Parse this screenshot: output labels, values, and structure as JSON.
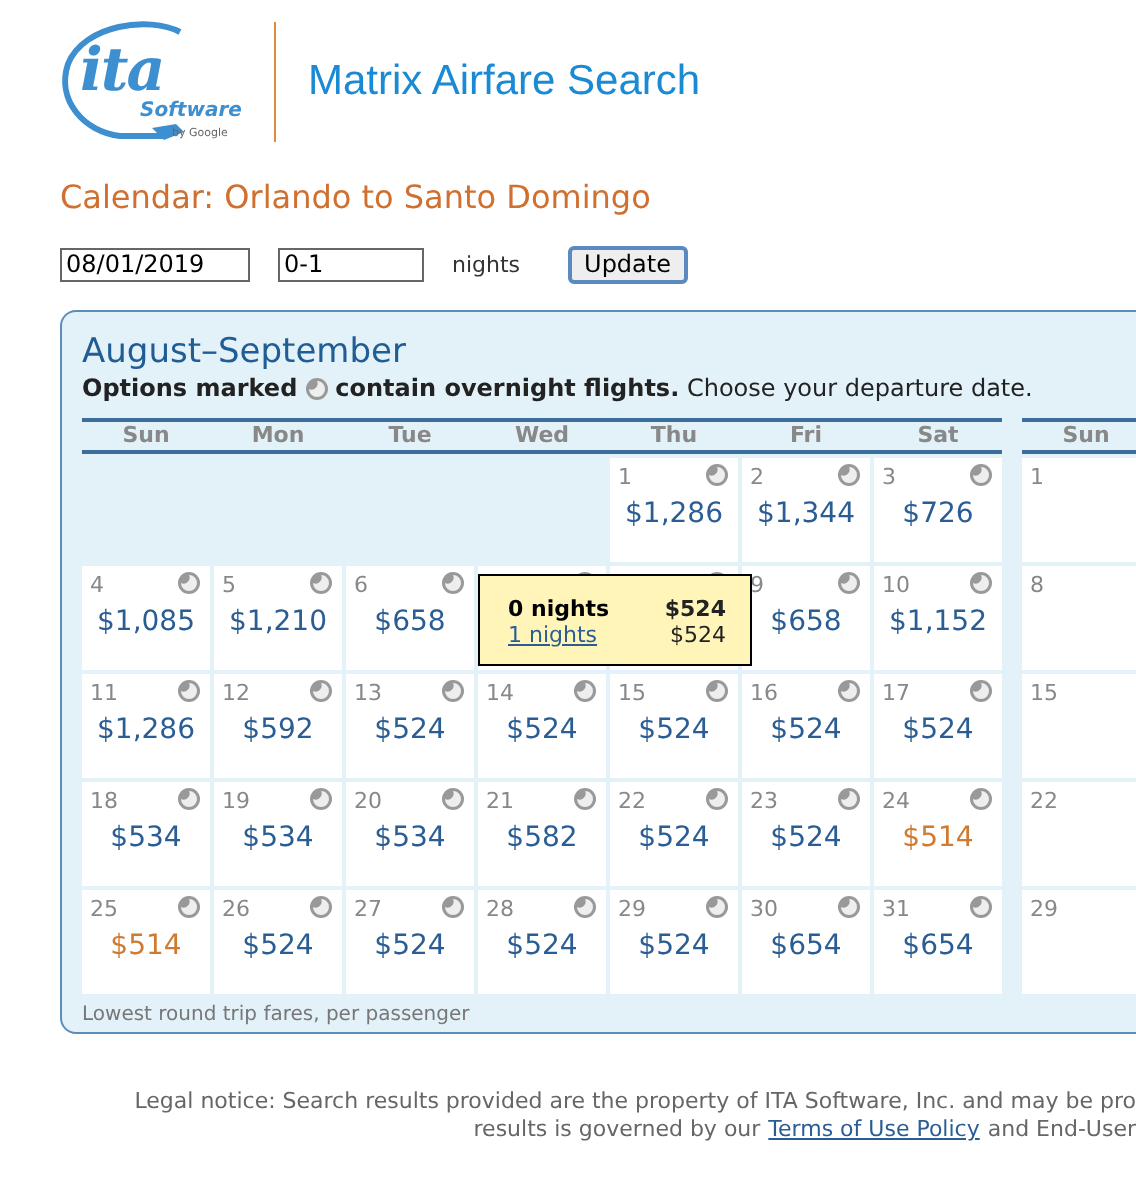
{
  "logo": {
    "mark": "ita",
    "sub": "Software",
    "by": "by Google"
  },
  "app_title": "Matrix Airfare Search",
  "heading": "Calendar: Orlando to Santo Domingo",
  "controls": {
    "date": "08/01/2019",
    "nights": "0-1",
    "nights_label": "nights",
    "button": "Update"
  },
  "calendar": {
    "title": "August–September",
    "legend_before": "Options marked",
    "legend_after": "**contain overnight flights.** Choose your departure date.",
    "weekdays": [
      "Sun",
      "Mon",
      "Tue",
      "Wed",
      "Thu",
      "Fri",
      "Sat"
    ],
    "weeks": [
      [
        {
          "kind": "empty"
        },
        {
          "kind": "empty"
        },
        {
          "kind": "empty"
        },
        {
          "kind": "empty"
        },
        {
          "kind": "fare",
          "day": "1",
          "price": "$1,286",
          "overnight": true,
          "lowest": false
        },
        {
          "kind": "fare",
          "day": "2",
          "price": "$1,344",
          "overnight": true,
          "lowest": false
        },
        {
          "kind": "fare",
          "day": "3",
          "price": "$726",
          "overnight": true,
          "lowest": false
        }
      ],
      [
        {
          "kind": "fare",
          "day": "4",
          "price": "$1,085",
          "overnight": true,
          "lowest": false
        },
        {
          "kind": "fare",
          "day": "5",
          "price": "$1,210",
          "overnight": true,
          "lowest": false
        },
        {
          "kind": "fare",
          "day": "6",
          "price": "$658",
          "overnight": true,
          "lowest": false
        },
        {
          "kind": "hidden",
          "overnight": true
        },
        {
          "kind": "hidden",
          "overnight": true
        },
        {
          "kind": "fare",
          "day": "9",
          "price": "$658",
          "overnight": true,
          "lowest": false
        },
        {
          "kind": "fare",
          "day": "10",
          "price": "$1,152",
          "overnight": true,
          "lowest": false
        }
      ],
      [
        {
          "kind": "fare",
          "day": "11",
          "price": "$1,286",
          "overnight": true,
          "lowest": false
        },
        {
          "kind": "fare",
          "day": "12",
          "price": "$592",
          "overnight": true,
          "lowest": false
        },
        {
          "kind": "fare",
          "day": "13",
          "price": "$524",
          "overnight": true,
          "lowest": false
        },
        {
          "kind": "fare",
          "day": "14",
          "price": "$524",
          "overnight": true,
          "lowest": false
        },
        {
          "kind": "fare",
          "day": "15",
          "price": "$524",
          "overnight": true,
          "lowest": false
        },
        {
          "kind": "fare",
          "day": "16",
          "price": "$524",
          "overnight": true,
          "lowest": false
        },
        {
          "kind": "fare",
          "day": "17",
          "price": "$524",
          "overnight": true,
          "lowest": false
        }
      ],
      [
        {
          "kind": "fare",
          "day": "18",
          "price": "$534",
          "overnight": true,
          "lowest": false
        },
        {
          "kind": "fare",
          "day": "19",
          "price": "$534",
          "overnight": true,
          "lowest": false
        },
        {
          "kind": "fare",
          "day": "20",
          "price": "$534",
          "overnight": true,
          "lowest": false
        },
        {
          "kind": "fare",
          "day": "21",
          "price": "$582",
          "overnight": true,
          "lowest": false
        },
        {
          "kind": "fare",
          "day": "22",
          "price": "$524",
          "overnight": true,
          "lowest": false
        },
        {
          "kind": "fare",
          "day": "23",
          "price": "$524",
          "overnight": true,
          "lowest": false
        },
        {
          "kind": "fare",
          "day": "24",
          "price": "$514",
          "overnight": true,
          "lowest": true
        }
      ],
      [
        {
          "kind": "fare",
          "day": "25",
          "price": "$514",
          "overnight": true,
          "lowest": true
        },
        {
          "kind": "fare",
          "day": "26",
          "price": "$524",
          "overnight": true,
          "lowest": false
        },
        {
          "kind": "fare",
          "day": "27",
          "price": "$524",
          "overnight": true,
          "lowest": false
        },
        {
          "kind": "fare",
          "day": "28",
          "price": "$524",
          "overnight": true,
          "lowest": false
        },
        {
          "kind": "fare",
          "day": "29",
          "price": "$524",
          "overnight": true,
          "lowest": false
        },
        {
          "kind": "fare",
          "day": "30",
          "price": "$654",
          "overnight": true,
          "lowest": false
        },
        {
          "kind": "fare",
          "day": "31",
          "price": "$654",
          "overnight": true,
          "lowest": false
        }
      ]
    ],
    "next_month": {
      "weekday": "Sun",
      "days": [
        "1",
        "8",
        "15",
        "22",
        "29"
      ]
    },
    "tooltip": {
      "rows": [
        {
          "label": "0 nights",
          "price": "$524",
          "selected": true
        },
        {
          "label": "1 nights",
          "price": "$524",
          "selected": false
        }
      ]
    },
    "footnote": "Lowest round trip fares, per passenger"
  },
  "legal": {
    "line_1": "Legal notice: Search results provided are the property of ITA Software, Inc. and may be pro",
    "line_2_before": "results is governed by our",
    "link": "Terms of Use Policy",
    "line_2_after": "and End-User"
  }
}
